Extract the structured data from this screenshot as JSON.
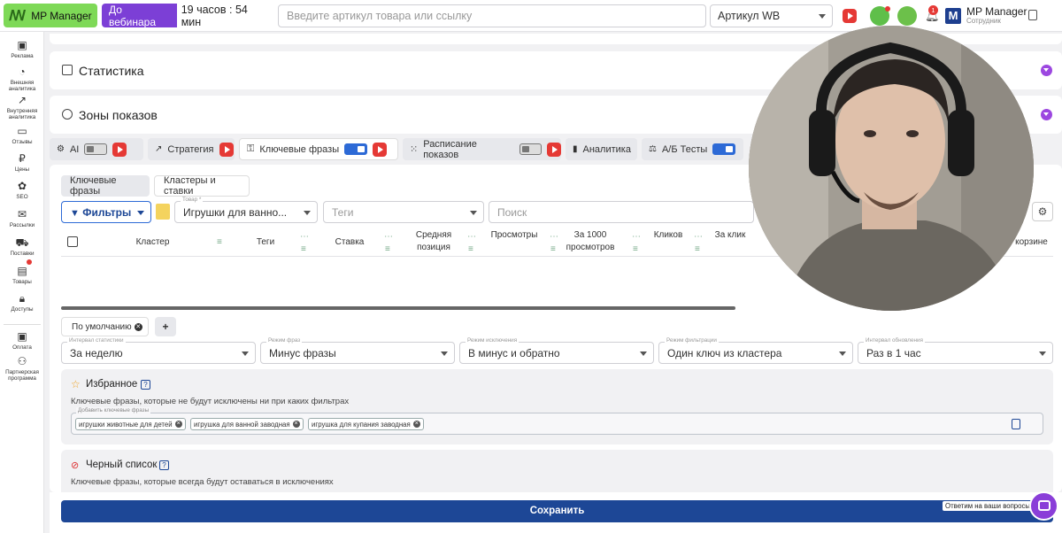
{
  "topbar": {
    "logo_text": "MP Manager",
    "webinar_label": "До вебинара",
    "webinar_timer": "19 часов : 54 мин",
    "search_placeholder": "Введите артикул товара или ссылку",
    "search_type": "Артикул WB",
    "notification_count": "1",
    "account_name": "MP Manager",
    "account_role": "Сотрудник"
  },
  "sidebar": {
    "items": [
      {
        "label": "Реклама",
        "icon": "megaphone-icon"
      },
      {
        "label": "Внешняя аналитика",
        "icon": "pie-chart-icon"
      },
      {
        "label": "Внутренняя аналитика",
        "icon": "trend-icon"
      },
      {
        "label": "Отзывы",
        "icon": "comment-icon"
      },
      {
        "label": "Цены",
        "icon": "ruble-icon"
      },
      {
        "label": "SEO",
        "icon": "seo-icon"
      },
      {
        "label": "Рассылки",
        "icon": "mail-icon"
      },
      {
        "label": "Поставки",
        "icon": "truck-icon"
      },
      {
        "label": "Товары",
        "icon": "box-icon"
      },
      {
        "label": "Доступы",
        "icon": "lock-icon"
      },
      {
        "label": "Оплата",
        "icon": "wallet-icon"
      },
      {
        "label": "Партнерская программа",
        "icon": "partners-icon"
      }
    ]
  },
  "sections": {
    "statistics_title": "Статистика",
    "zones_title": "Зоны показов"
  },
  "tabs": [
    {
      "label": "AI"
    },
    {
      "label": "Стратегия"
    },
    {
      "label": "Ключевые фразы"
    },
    {
      "label": "Расписание показов"
    },
    {
      "label": "Аналитика"
    },
    {
      "label": "А/Б Тесты"
    }
  ],
  "subtabs": {
    "keywords": "Ключевые фразы",
    "clusters": "Кластеры и ставки"
  },
  "filters": {
    "filters_button": "Фильтры",
    "product_label": "Товар *",
    "product_value": "Игрушки для ванно...",
    "tags_placeholder": "Теги",
    "search_placeholder": "Поиск"
  },
  "table": {
    "headers": [
      "Кластер",
      "Теги",
      "Ставка",
      "Средняя позиция",
      "Просмотры",
      "За 1000 просмотров",
      "Кликов",
      "За клик",
      "корзине"
    ]
  },
  "presets": {
    "default_label": "По умолчанию"
  },
  "settings": [
    {
      "label": "Интервал статистики",
      "value": "За неделю"
    },
    {
      "label": "Режим фраз",
      "value": "Минус фразы"
    },
    {
      "label": "Режим исключения",
      "value": "В минус и обратно"
    },
    {
      "label": "Режим фильтрации",
      "value": "Один ключ из кластера"
    },
    {
      "label": "Интервал обновления",
      "value": "Раз в 1 час"
    }
  ],
  "favorites": {
    "title": "Избранное",
    "help": "?",
    "description": "Ключевые фразы, которые не будут исключены ни при каких фильтрах",
    "input_label": "Добавить ключевые фразы",
    "chips": [
      "игрушки животные для детей",
      "игрушка для ванной заводная",
      "игрушка для купания заводная"
    ]
  },
  "blacklist": {
    "title": "Черный список",
    "help": "?",
    "description": "Ключевые фразы, которые всегда будут оставаться в исключениях"
  },
  "save_label": "Сохранить",
  "support_label": "Ответим на ваши вопросы",
  "colors": {
    "accent": "#1d4796",
    "green": "#7ed957",
    "purple": "#7c3fd6",
    "toggle": "#2d6ad6"
  }
}
